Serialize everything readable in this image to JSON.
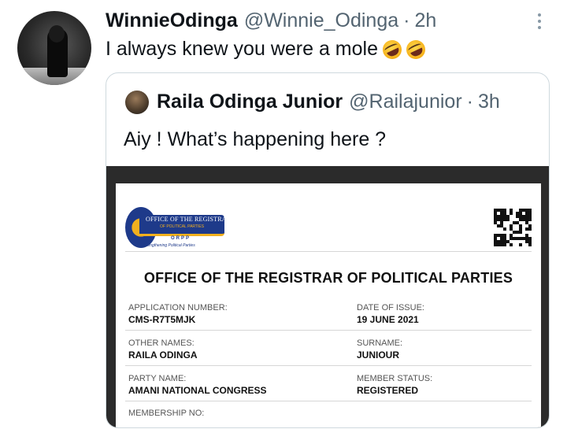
{
  "tweet": {
    "display_name": "WinnieOdinga",
    "handle": "@Winnie_Odinga",
    "separator": "·",
    "time": "2h",
    "text": "I always knew you were a mole",
    "emojis": [
      "rolling-on-floor-laughing-emoji",
      "rolling-on-floor-laughing-emoji"
    ],
    "more_icon": "more-vertical-icon"
  },
  "quoted_tweet": {
    "display_name": "Raila Odinga Junior",
    "handle": "@Railajunior",
    "separator": "·",
    "time": "3h",
    "text": "Aiy ! What’s happening here ?"
  },
  "document": {
    "logo": {
      "title": "OFFICE OF THE REGISTRAR",
      "subtitle": "OF POLITICAL PARTIES",
      "acronym": "ORPP",
      "tagline": "Strengthening Political Parties"
    },
    "heading": "OFFICE OF THE REGISTRAR OF POLITICAL PARTIES",
    "fields": [
      {
        "label": "APPLICATION NUMBER:",
        "value": "CMS-R7T5MJK"
      },
      {
        "label": "DATE OF ISSUE:",
        "value": "19 JUNE 2021"
      },
      {
        "label": "OTHER NAMES:",
        "value": "RAILA ODINGA"
      },
      {
        "label": "SURNAME:",
        "value": "JUNIOUR"
      },
      {
        "label": "PARTY NAME:",
        "value": "AMANI NATIONAL CONGRESS"
      },
      {
        "label": "MEMBER STATUS:",
        "value": "REGISTERED"
      },
      {
        "label": "MEMBERSHIP NO:",
        "value": ""
      }
    ]
  },
  "colors": {
    "text_primary": "#0f1419",
    "text_secondary": "#536471",
    "card_border": "#cfd9de",
    "logo_blue": "#1e3a8a",
    "logo_gold": "#f2b01e"
  }
}
